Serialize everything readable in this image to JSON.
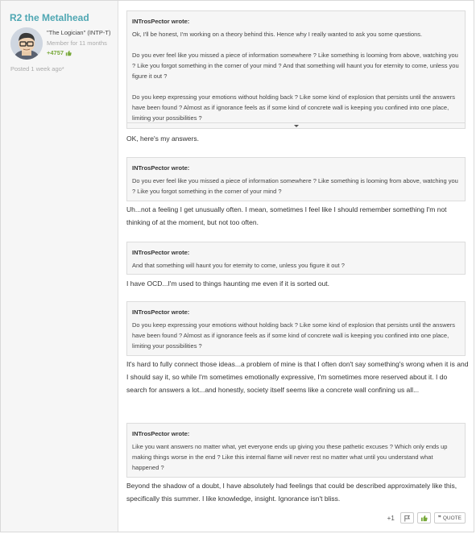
{
  "user": {
    "name": "R2 the Metalhead",
    "title": "\"The Logician\" (INTP-T)",
    "member_for": "Member for 11 months",
    "reputation": "+4757",
    "posted": "Posted 1 week ago*"
  },
  "quotes": [
    {
      "author": "INTrosPector wrote:",
      "paragraphs": [
        "Ok, I'll be honest, I'm working on a theory behind this. Hence why I really wanted to ask you some questions.",
        "Do you ever feel like you missed a piece of information somewhere ? Like something is looming from above, watching you ? Like you forgot something in the corner of your mind ? And that something will haunt you for eternity to come, unless you figure it out ?",
        "Do you keep expressing your emotions without holding back ? Like some kind of explosion that persists until the answers have been found ? Almost as if ignorance feels as if some kind of concrete wall is keeping you confined into one place, limiting your possibilities ?"
      ]
    },
    {
      "author": "INTrosPector wrote:",
      "text": "Do you ever feel like you missed a piece of information somewhere ? Like something is looming from above, watching you ? Like you forgot something in the corner of your mind ?"
    },
    {
      "author": "INTrosPector wrote:",
      "text": "And that something will haunt you for eternity to come, unless you figure it out ?"
    },
    {
      "author": "INTrosPector wrote:",
      "text": "Do you keep expressing your emotions without holding back ? Like some kind of explosion that persists until the answers have been found ? Almost as if ignorance feels as if some kind of concrete wall is keeping you confined into one place, limiting your possibilities ?"
    },
    {
      "author": "INTrosPector wrote:",
      "text": "Like you want answers no matter what, yet everyone ends up giving you these pathetic excuses ? Which only ends up making things worse in the end ? Like this internal flame will never rest no matter what until you understand what happened ?"
    }
  ],
  "replies": [
    "OK, here's my answers.",
    "Uh...not a feeling I get unusually often.  I mean, sometimes I feel like I should remember something I'm not thinking of at the moment, but not too often.",
    "I have OCD...I'm used to things haunting me even if it is sorted out.",
    "It's hard to fully connect those ideas...a problem of mine is that I often don't say something's wrong when it is and I should say it, so while I'm sometimes emotionally expressive, I'm sometimes more reserved about it.  I do search for answers a lot...and honestly, society itself seems like a concrete wall confining us all...",
    "Beyond the shadow of a doubt, I have absolutely had feelings that could be described approximately like this, specifically this summer.  I like knowledge, insight.  Ignorance isn't bliss."
  ],
  "footer": {
    "plus_count": "+1",
    "quote_label": "QUOTE"
  },
  "colors": {
    "username": "#4fa7b3",
    "reputation": "#78a93a"
  },
  "icons": [
    "flag-icon",
    "like-icon",
    "quote-icon",
    "thumbs-up-icon",
    "scroll-down-icon"
  ]
}
